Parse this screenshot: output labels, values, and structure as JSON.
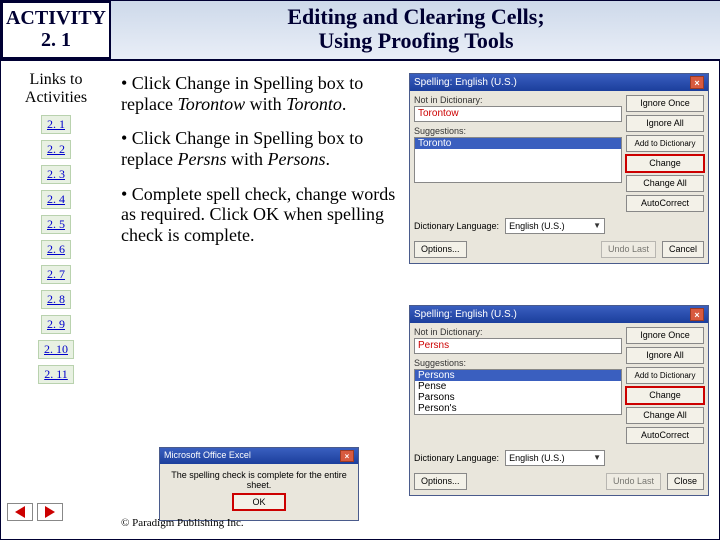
{
  "header": {
    "activity_label": "ACTIVITY",
    "activity_num": "2. 1",
    "title_line1": "Editing and Clearing Cells;",
    "title_line2": "Using Proofing Tools"
  },
  "sidebar": {
    "heading_l1": "Links to",
    "heading_l2": "Activities",
    "items": [
      {
        "label": "2. 1"
      },
      {
        "label": "2. 2"
      },
      {
        "label": "2. 3"
      },
      {
        "label": "2. 4"
      },
      {
        "label": "2. 5"
      },
      {
        "label": "2. 6"
      },
      {
        "label": "2. 7"
      },
      {
        "label": "2. 8"
      },
      {
        "label": "2. 9"
      },
      {
        "label": "2. 10"
      },
      {
        "label": "2. 11"
      }
    ]
  },
  "body": {
    "b1_pre": "• Click Change in Spelling box to replace ",
    "b1_i1": "Torontow",
    "b1_mid": " with ",
    "b1_i2": "Toronto",
    "b1_post": ".",
    "b2_pre": "• Click Change in Spelling box to replace ",
    "b2_i1": "Persns",
    "b2_mid": " with ",
    "b2_i2": "Persons",
    "b2_post": ".",
    "b3": "• Complete spell check, change words as required. Click OK when spelling check is complete."
  },
  "dialog1": {
    "title": "Spelling: English (U.S.)",
    "not_in_dict_label": "Not in Dictionary:",
    "not_in_dict_value": "Torontow",
    "suggestions_label": "Suggestions:",
    "suggestion_selected": "Toronto",
    "dict_lang_label": "Dictionary Language:",
    "dict_lang_value": "English (U.S.)",
    "btn_ignore_once": "Ignore Once",
    "btn_ignore_all": "Ignore All",
    "btn_add": "Add to Dictionary",
    "btn_change": "Change",
    "btn_change_all": "Change All",
    "btn_autocorrect": "AutoCorrect",
    "btn_options": "Options...",
    "btn_undo": "Undo Last",
    "btn_cancel": "Cancel"
  },
  "dialog2": {
    "title": "Spelling: English (U.S.)",
    "not_in_dict_label": "Not in Dictionary:",
    "not_in_dict_value": "Persns",
    "suggestions_label": "Suggestions:",
    "suggestions": [
      "Persons",
      "Pense",
      "Parsons",
      "Person's"
    ],
    "dict_lang_label": "Dictionary Language:",
    "dict_lang_value": "English (U.S.)",
    "btn_ignore_once": "Ignore Once",
    "btn_ignore_all": "Ignore All",
    "btn_add": "Add to Dictionary",
    "btn_change": "Change",
    "btn_change_all": "Change All",
    "btn_autocorrect": "AutoCorrect",
    "btn_options": "Options...",
    "btn_undo": "Undo Last",
    "btn_close": "Close"
  },
  "msgbox": {
    "title": "Microsoft Office Excel",
    "text": "The spelling check is complete for the entire sheet.",
    "ok": "OK"
  },
  "footer": {
    "copyright": "© Paradigm Publishing Inc."
  }
}
